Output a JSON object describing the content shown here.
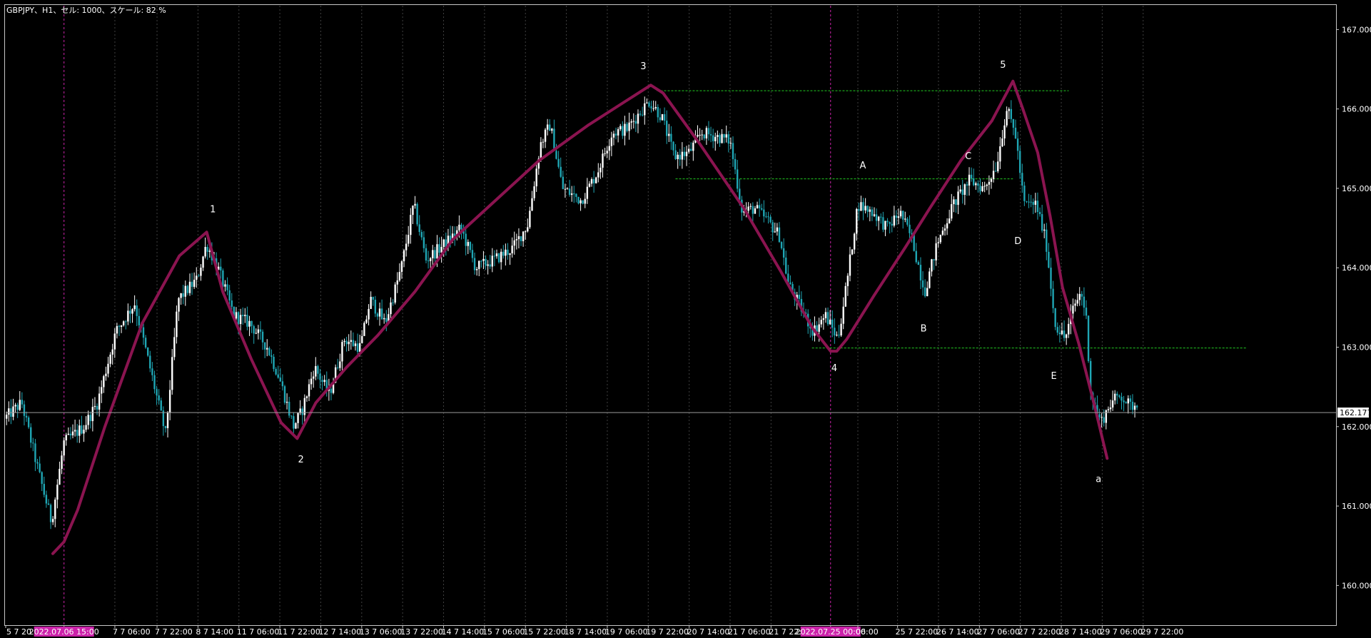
{
  "header": {
    "text": "GBPJPY、H1、セル: 1000、スケール: 82 %"
  },
  "colors": {
    "background": "#000000",
    "frame": "#c8c8c8",
    "grid": "#404040",
    "bull_candle": "#ffffff",
    "bear_candle": "#1fa6b4",
    "wave_line": "#8b1450",
    "level_line": "#22cc22",
    "date_marker": "#cc22aa",
    "price_line": "#9a9a9a"
  },
  "chart_data": {
    "type": "candlestick",
    "symbol": "GBPJPY",
    "timeframe": "H1",
    "ylim": [
      159.5,
      167.3
    ],
    "y_ticks": [
      "160.000",
      "161.000",
      "162.000",
      "163.000",
      "164.000",
      "165.000",
      "166.000",
      "167.000"
    ],
    "y_tick_values": [
      160,
      161,
      162,
      163,
      164,
      165,
      166,
      167
    ],
    "current_price": {
      "value": 162.177,
      "label": "162.177"
    },
    "x_range": [
      0,
      1000
    ],
    "x_ticks": [
      {
        "x": 0,
        "label": "5 7 20"
      },
      {
        "x": 47,
        "label": "2022.07.06 15:00",
        "highlight": true
      },
      {
        "x": 88,
        "label": "7 7 06:00"
      },
      {
        "x": 122,
        "label": "7 7 22:00"
      },
      {
        "x": 155,
        "label": "8 7 14:00"
      },
      {
        "x": 188,
        "label": "11 7 06:00"
      },
      {
        "x": 221,
        "label": "11 7 22:00"
      },
      {
        "x": 254,
        "label": "12 7 14:00"
      },
      {
        "x": 287,
        "label": "13 7 06:00"
      },
      {
        "x": 320,
        "label": "13 7 22:00"
      },
      {
        "x": 353,
        "label": "14 7 14:00"
      },
      {
        "x": 386,
        "label": "15 7 06:00"
      },
      {
        "x": 419,
        "label": "15 7 22:00"
      },
      {
        "x": 452,
        "label": "18 7 14:00"
      },
      {
        "x": 485,
        "label": "19 7 06:00"
      },
      {
        "x": 518,
        "label": "19 7 22:00"
      },
      {
        "x": 551,
        "label": "20 7 14:00"
      },
      {
        "x": 584,
        "label": "21 7 06:00"
      },
      {
        "x": 617,
        "label": "21 7 22:00"
      },
      {
        "x": 665,
        "label": "2022.07.25 00:00",
        "highlight": true
      },
      {
        "x": 687,
        "label": "06:00"
      },
      {
        "x": 719,
        "label": "25 7 22:00"
      },
      {
        "x": 752,
        "label": "26 7 14:00"
      },
      {
        "x": 785,
        "label": "27 7 06:00"
      },
      {
        "x": 818,
        "label": "27 7 22:00"
      },
      {
        "x": 851,
        "label": "28 7 14:00"
      },
      {
        "x": 884,
        "label": "29 7 06:00"
      },
      {
        "x": 917,
        "label": "29 7 22:00"
      }
    ],
    "wave_path": [
      {
        "x": 38,
        "y": 160.4
      },
      {
        "x": 47,
        "y": 160.55
      },
      {
        "x": 58,
        "y": 160.95
      },
      {
        "x": 80,
        "y": 162.0
      },
      {
        "x": 110,
        "y": 163.3
      },
      {
        "x": 140,
        "y": 164.15
      },
      {
        "x": 162,
        "y": 164.45
      },
      {
        "x": 175,
        "y": 163.7
      },
      {
        "x": 198,
        "y": 162.85
      },
      {
        "x": 222,
        "y": 162.05
      },
      {
        "x": 235,
        "y": 161.85
      },
      {
        "x": 250,
        "y": 162.3
      },
      {
        "x": 275,
        "y": 162.75
      },
      {
        "x": 300,
        "y": 163.15
      },
      {
        "x": 330,
        "y": 163.7
      },
      {
        "x": 360,
        "y": 164.35
      },
      {
        "x": 395,
        "y": 164.85
      },
      {
        "x": 430,
        "y": 165.35
      },
      {
        "x": 470,
        "y": 165.8
      },
      {
        "x": 500,
        "y": 166.1
      },
      {
        "x": 520,
        "y": 166.3
      },
      {
        "x": 530,
        "y": 166.2
      },
      {
        "x": 560,
        "y": 165.55
      },
      {
        "x": 595,
        "y": 164.75
      },
      {
        "x": 625,
        "y": 163.95
      },
      {
        "x": 650,
        "y": 163.25
      },
      {
        "x": 665,
        "y": 162.95
      },
      {
        "x": 670,
        "y": 162.95
      },
      {
        "x": 678,
        "y": 163.1
      },
      {
        "x": 700,
        "y": 163.65
      },
      {
        "x": 725,
        "y": 164.25
      },
      {
        "x": 745,
        "y": 164.75
      },
      {
        "x": 770,
        "y": 165.35
      },
      {
        "x": 795,
        "y": 165.85
      },
      {
        "x": 812,
        "y": 166.35
      },
      {
        "x": 820,
        "y": 166.0
      },
      {
        "x": 832,
        "y": 165.45
      },
      {
        "x": 842,
        "y": 164.65
      },
      {
        "x": 852,
        "y": 163.75
      },
      {
        "x": 865,
        "y": 163.05
      },
      {
        "x": 878,
        "y": 162.25
      },
      {
        "x": 888,
        "y": 161.6
      }
    ],
    "wave_labels": [
      {
        "text": "1",
        "x": 167,
        "y": 164.7
      },
      {
        "text": "2",
        "x": 238,
        "y": 161.55
      },
      {
        "text": "3",
        "x": 514,
        "y": 166.5
      },
      {
        "text": "4",
        "x": 668,
        "y": 162.7
      },
      {
        "text": "5",
        "x": 804,
        "y": 166.52
      },
      {
        "text": "A",
        "x": 691,
        "y": 165.25
      },
      {
        "text": "B",
        "x": 740,
        "y": 163.2
      },
      {
        "text": "C",
        "x": 776,
        "y": 165.37
      },
      {
        "text": "D",
        "x": 816,
        "y": 164.3
      },
      {
        "text": "E",
        "x": 845,
        "y": 162.6
      },
      {
        "text": "a",
        "x": 881,
        "y": 161.3
      }
    ],
    "horizontal_levels": [
      {
        "y": 166.23,
        "x1": 525,
        "x2": 857
      },
      {
        "y": 165.12,
        "x1": 540,
        "x2": 812
      },
      {
        "y": 162.99,
        "x1": 650,
        "x2": 1000
      }
    ],
    "highlight_verticals": [
      47,
      665
    ],
    "candle_anchors": [
      {
        "x": 0,
        "y": 162.1
      },
      {
        "x": 14,
        "y": 162.3
      },
      {
        "x": 28,
        "y": 161.4
      },
      {
        "x": 38,
        "y": 160.8
      },
      {
        "x": 48,
        "y": 161.8
      },
      {
        "x": 64,
        "y": 162.0
      },
      {
        "x": 75,
        "y": 162.3
      },
      {
        "x": 90,
        "y": 163.2
      },
      {
        "x": 105,
        "y": 163.55
      },
      {
        "x": 118,
        "y": 162.7
      },
      {
        "x": 130,
        "y": 161.9
      },
      {
        "x": 140,
        "y": 163.6
      },
      {
        "x": 155,
        "y": 163.85
      },
      {
        "x": 163,
        "y": 164.3
      },
      {
        "x": 172,
        "y": 164.0
      },
      {
        "x": 185,
        "y": 163.4
      },
      {
        "x": 198,
        "y": 163.3
      },
      {
        "x": 212,
        "y": 163.0
      },
      {
        "x": 222,
        "y": 162.6
      },
      {
        "x": 233,
        "y": 162.0
      },
      {
        "x": 240,
        "y": 162.2
      },
      {
        "x": 250,
        "y": 162.75
      },
      {
        "x": 262,
        "y": 162.4
      },
      {
        "x": 274,
        "y": 163.1
      },
      {
        "x": 287,
        "y": 163.0
      },
      {
        "x": 295,
        "y": 163.6
      },
      {
        "x": 307,
        "y": 163.3
      },
      {
        "x": 320,
        "y": 164.0
      },
      {
        "x": 330,
        "y": 164.8
      },
      {
        "x": 340,
        "y": 164.1
      },
      {
        "x": 355,
        "y": 164.3
      },
      {
        "x": 368,
        "y": 164.5
      },
      {
        "x": 380,
        "y": 164.0
      },
      {
        "x": 395,
        "y": 164.1
      },
      {
        "x": 410,
        "y": 164.25
      },
      {
        "x": 422,
        "y": 164.55
      },
      {
        "x": 432,
        "y": 165.55
      },
      {
        "x": 440,
        "y": 165.8
      },
      {
        "x": 450,
        "y": 165.0
      },
      {
        "x": 465,
        "y": 164.85
      },
      {
        "x": 478,
        "y": 165.2
      },
      {
        "x": 490,
        "y": 165.7
      },
      {
        "x": 502,
        "y": 165.75
      },
      {
        "x": 512,
        "y": 165.95
      },
      {
        "x": 520,
        "y": 166.1
      },
      {
        "x": 530,
        "y": 165.9
      },
      {
        "x": 540,
        "y": 165.4
      },
      {
        "x": 552,
        "y": 165.45
      },
      {
        "x": 562,
        "y": 165.7
      },
      {
        "x": 575,
        "y": 165.65
      },
      {
        "x": 585,
        "y": 165.6
      },
      {
        "x": 595,
        "y": 164.7
      },
      {
        "x": 605,
        "y": 164.75
      },
      {
        "x": 615,
        "y": 164.6
      },
      {
        "x": 625,
        "y": 164.4
      },
      {
        "x": 632,
        "y": 163.8
      },
      {
        "x": 642,
        "y": 163.5
      },
      {
        "x": 652,
        "y": 163.2
      },
      {
        "x": 662,
        "y": 163.4
      },
      {
        "x": 672,
        "y": 163.1
      },
      {
        "x": 680,
        "y": 163.9
      },
      {
        "x": 688,
        "y": 164.8
      },
      {
        "x": 700,
        "y": 164.7
      },
      {
        "x": 712,
        "y": 164.5
      },
      {
        "x": 722,
        "y": 164.7
      },
      {
        "x": 732,
        "y": 164.35
      },
      {
        "x": 742,
        "y": 163.7
      },
      {
        "x": 752,
        "y": 164.3
      },
      {
        "x": 765,
        "y": 164.8
      },
      {
        "x": 778,
        "y": 165.1
      },
      {
        "x": 790,
        "y": 165.0
      },
      {
        "x": 800,
        "y": 165.3
      },
      {
        "x": 808,
        "y": 166.0
      },
      {
        "x": 815,
        "y": 165.7
      },
      {
        "x": 822,
        "y": 164.8
      },
      {
        "x": 832,
        "y": 164.8
      },
      {
        "x": 840,
        "y": 164.3
      },
      {
        "x": 847,
        "y": 163.3
      },
      {
        "x": 855,
        "y": 163.1
      },
      {
        "x": 862,
        "y": 163.5
      },
      {
        "x": 868,
        "y": 163.7
      },
      {
        "x": 872,
        "y": 163.4
      },
      {
        "x": 876,
        "y": 162.4
      },
      {
        "x": 884,
        "y": 162.05
      },
      {
        "x": 892,
        "y": 162.3
      },
      {
        "x": 900,
        "y": 162.4
      },
      {
        "x": 908,
        "y": 162.25
      },
      {
        "x": 913,
        "y": 162.3
      }
    ]
  }
}
